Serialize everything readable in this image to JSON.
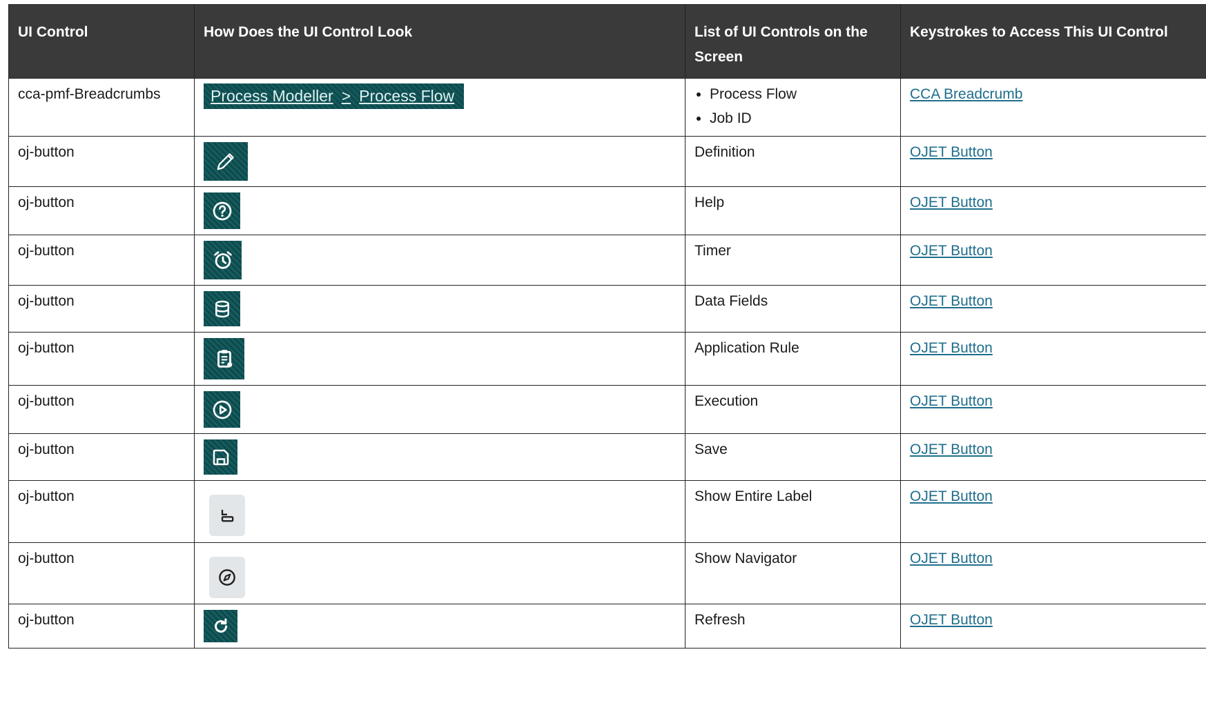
{
  "headers": {
    "ui_control": "UI Control",
    "look": "How Does the UI Control Look",
    "list": "List of UI Controls on the Screen",
    "keystrokes": "Keystrokes to Access This UI Control"
  },
  "breadcrumb": {
    "control": "cca-pmf-Breadcrumbs",
    "seg1": "Process Modeller",
    "sep": ">",
    "seg2": "Process Flow",
    "items": [
      "Process Flow",
      "Job ID"
    ],
    "link": "CCA Breadcrumb"
  },
  "rows": [
    {
      "control": "oj-button",
      "icon": "pencil-icon",
      "label": "Definition",
      "link": "OJET Button"
    },
    {
      "control": "oj-button",
      "icon": "help-icon",
      "label": "Help",
      "link": "OJET Button"
    },
    {
      "control": "oj-button",
      "icon": "alarm-clock-icon",
      "label": "Timer",
      "link": "OJET Button"
    },
    {
      "control": "oj-button",
      "icon": "database-icon",
      "label": "Data Fields",
      "link": "OJET Button"
    },
    {
      "control": "oj-button",
      "icon": "clipboard-rule-icon",
      "label": "Application Rule",
      "link": "OJET Button"
    },
    {
      "control": "oj-button",
      "icon": "play-circle-icon",
      "label": "Execution",
      "link": "OJET Button"
    },
    {
      "control": "oj-button",
      "icon": "save-icon",
      "label": "Save",
      "link": "OJET Button"
    },
    {
      "control": "oj-button",
      "icon": "label-icon",
      "label": "Show Entire Label",
      "link": "OJET Button"
    },
    {
      "control": "oj-button",
      "icon": "compass-icon",
      "label": "Show Navigator",
      "link": "OJET Button"
    },
    {
      "control": "oj-button",
      "icon": "refresh-icon",
      "label": "Refresh",
      "link": "OJET Button"
    }
  ],
  "colors": {
    "header_bg": "#3a3a3a",
    "link": "#1f6e8c",
    "icon_tile": "#0e4a4c"
  }
}
